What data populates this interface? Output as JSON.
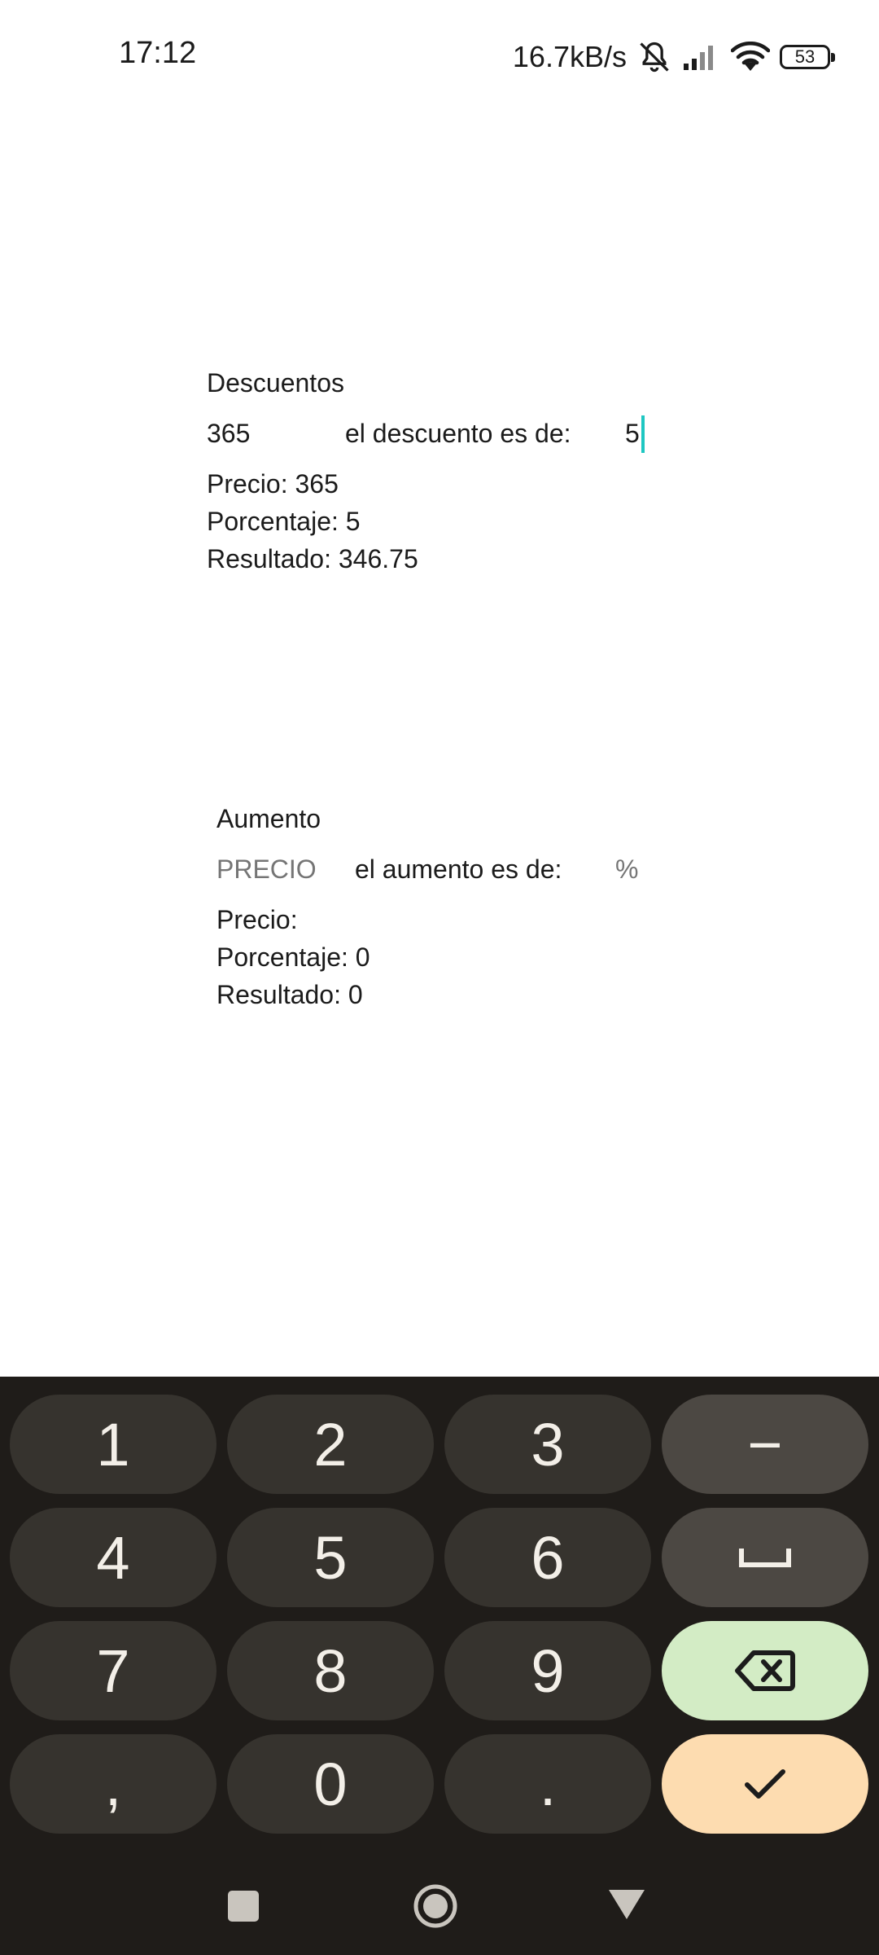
{
  "status_bar": {
    "time": "17:12",
    "net_speed": "16.7kB/s",
    "battery": "53",
    "icons": [
      "mute-bell-icon",
      "signal-icon",
      "wifi-icon",
      "battery-icon"
    ]
  },
  "descuentos": {
    "title": "Descuentos",
    "price_value": "365",
    "label": "el descuento es de:",
    "percent_value": "5",
    "results": {
      "precio": "Precio: 365",
      "porcentaje": "Porcentaje: 5",
      "resultado": "Resultado: 346.75"
    }
  },
  "aumento": {
    "title": "Aumento",
    "price_placeholder": "PRECIO",
    "label": "el aumento es de:",
    "percent_placeholder": "%",
    "results": {
      "precio": "Precio:",
      "porcentaje": "Porcentaje: 0",
      "resultado": "Resultado: 0"
    }
  },
  "keyboard": {
    "keys": [
      "1",
      "2",
      "3",
      "−",
      "4",
      "5",
      "6",
      "␣",
      "7",
      "8",
      "9",
      "⌫",
      ",",
      "0",
      ".",
      "✓"
    ],
    "colors": {
      "background": "#1f1c19",
      "key": "#36332e",
      "function_key": "#4c4843",
      "delete_key": "#d3ecc5",
      "enter_key": "#fddcb0"
    }
  },
  "nav_bar": {
    "icons": [
      "recents-square-icon",
      "home-circle-icon",
      "back-triangle-icon"
    ]
  }
}
